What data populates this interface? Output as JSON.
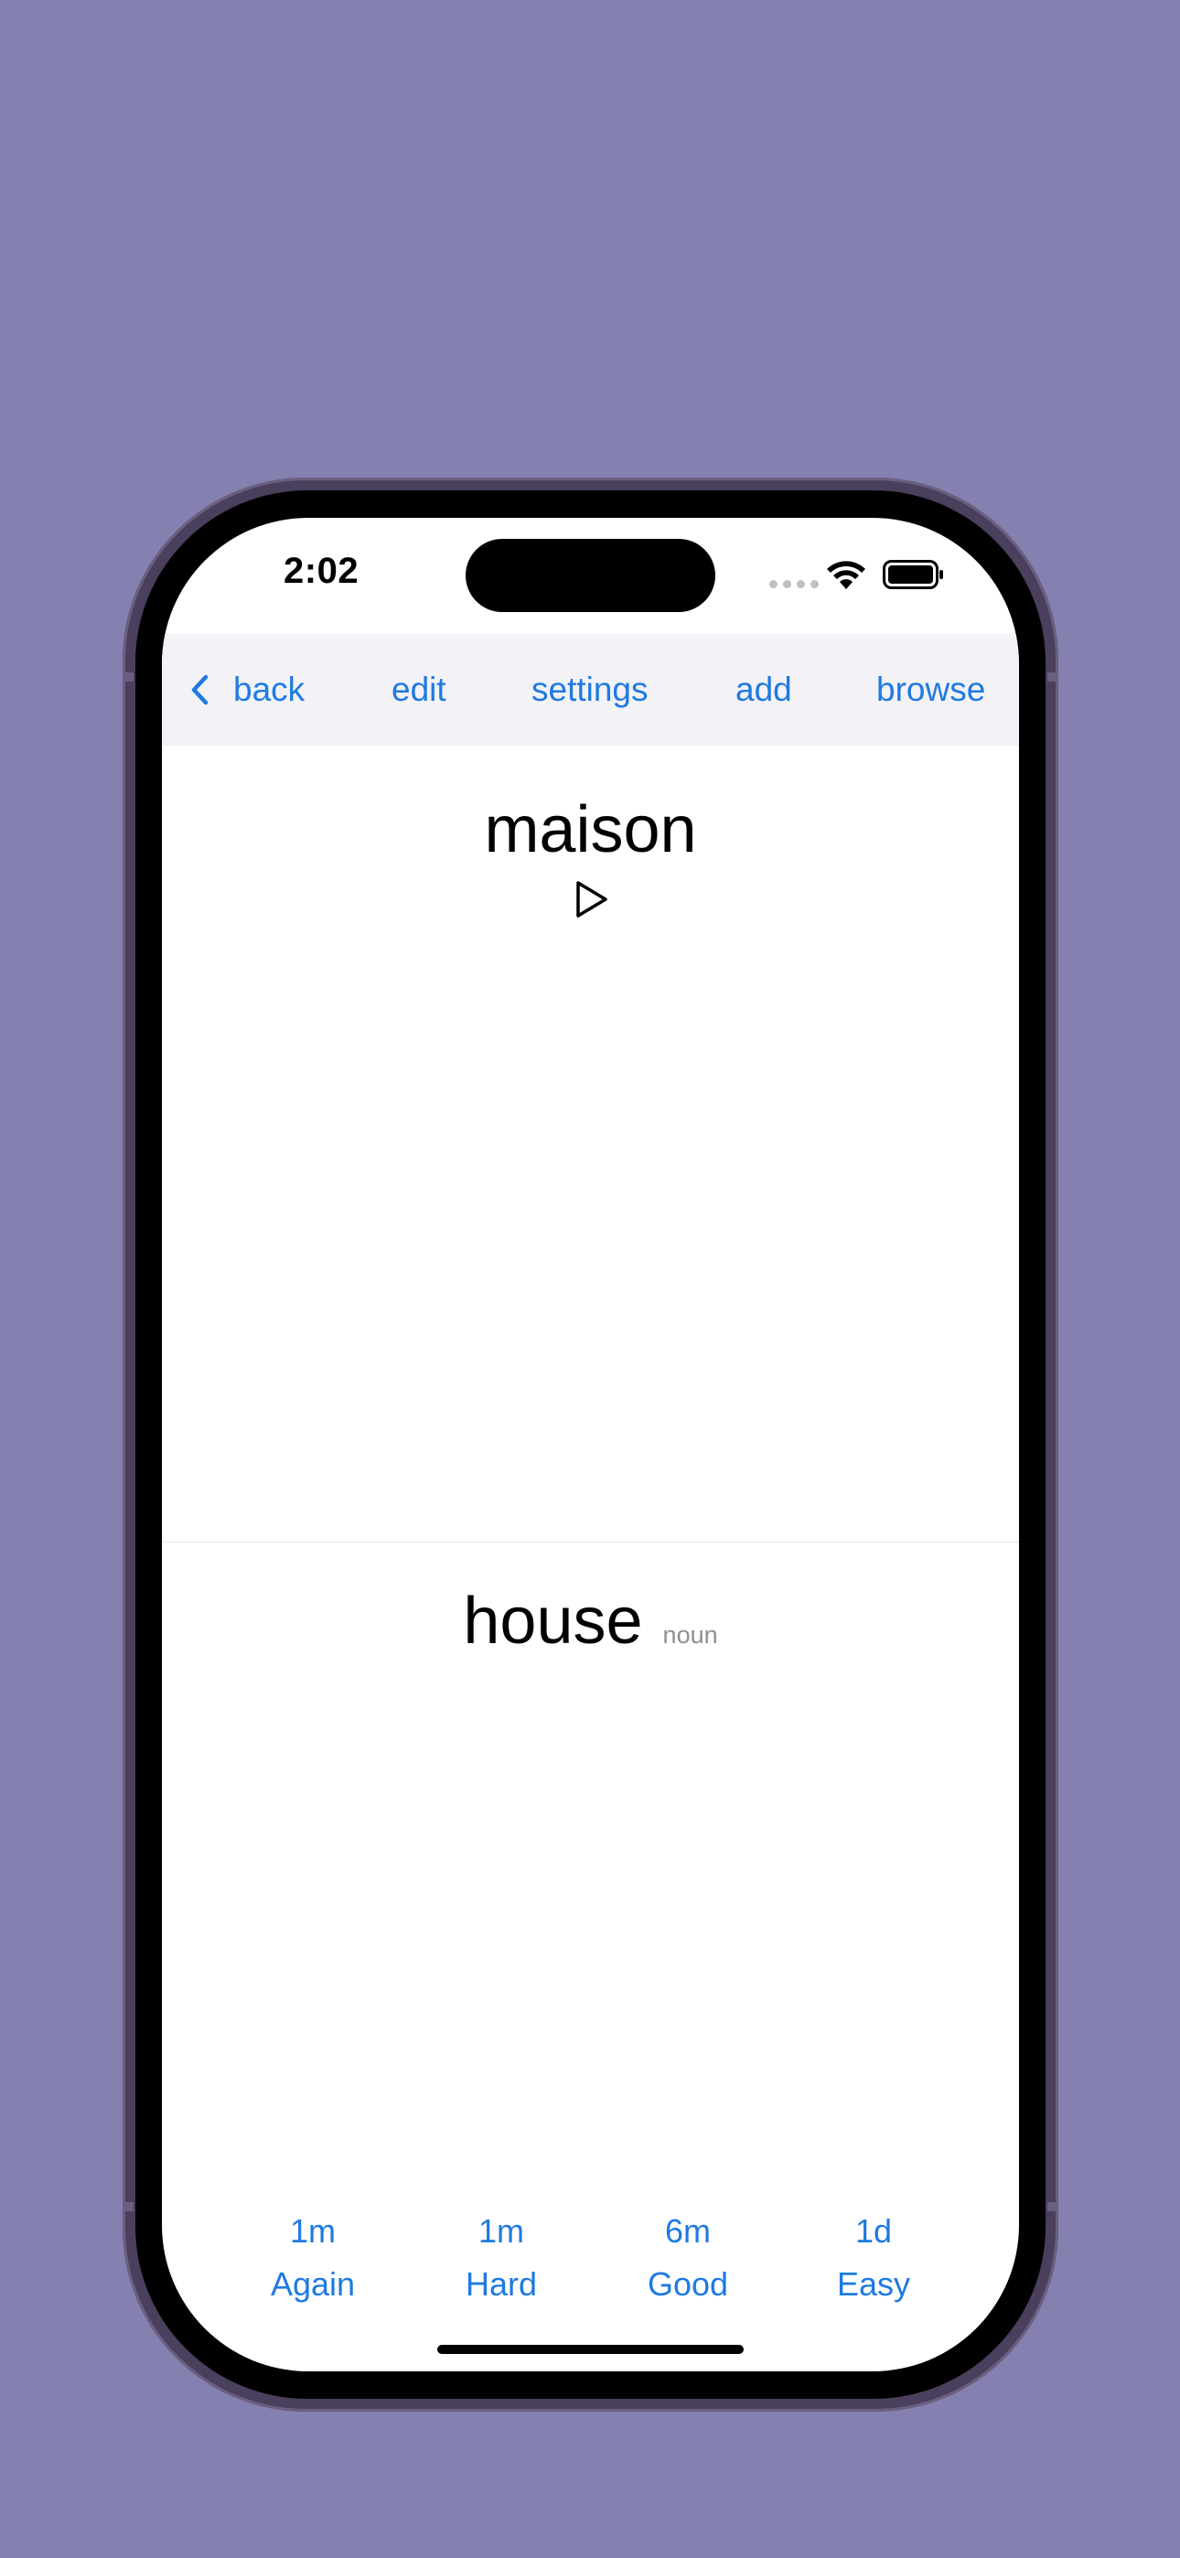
{
  "status_bar": {
    "time": "2:02"
  },
  "toolbar": {
    "back_label": "back",
    "edit_label": "edit",
    "settings_label": "settings",
    "add_label": "add",
    "browse_label": "browse"
  },
  "card": {
    "front": "maison",
    "back": "house",
    "part_of_speech": "noun"
  },
  "answers": [
    {
      "interval": "1m",
      "label": "Again"
    },
    {
      "interval": "1m",
      "label": "Hard"
    },
    {
      "interval": "6m",
      "label": "Good"
    },
    {
      "interval": "1d",
      "label": "Easy"
    }
  ],
  "colors": {
    "accent": "#1f7ae0",
    "background": "#8481b0",
    "toolbar_background": "#f2f2f7"
  },
  "icons": [
    "chevron-left-icon",
    "play-icon",
    "wifi-icon",
    "battery-icon",
    "cellular-signal-icon"
  ]
}
